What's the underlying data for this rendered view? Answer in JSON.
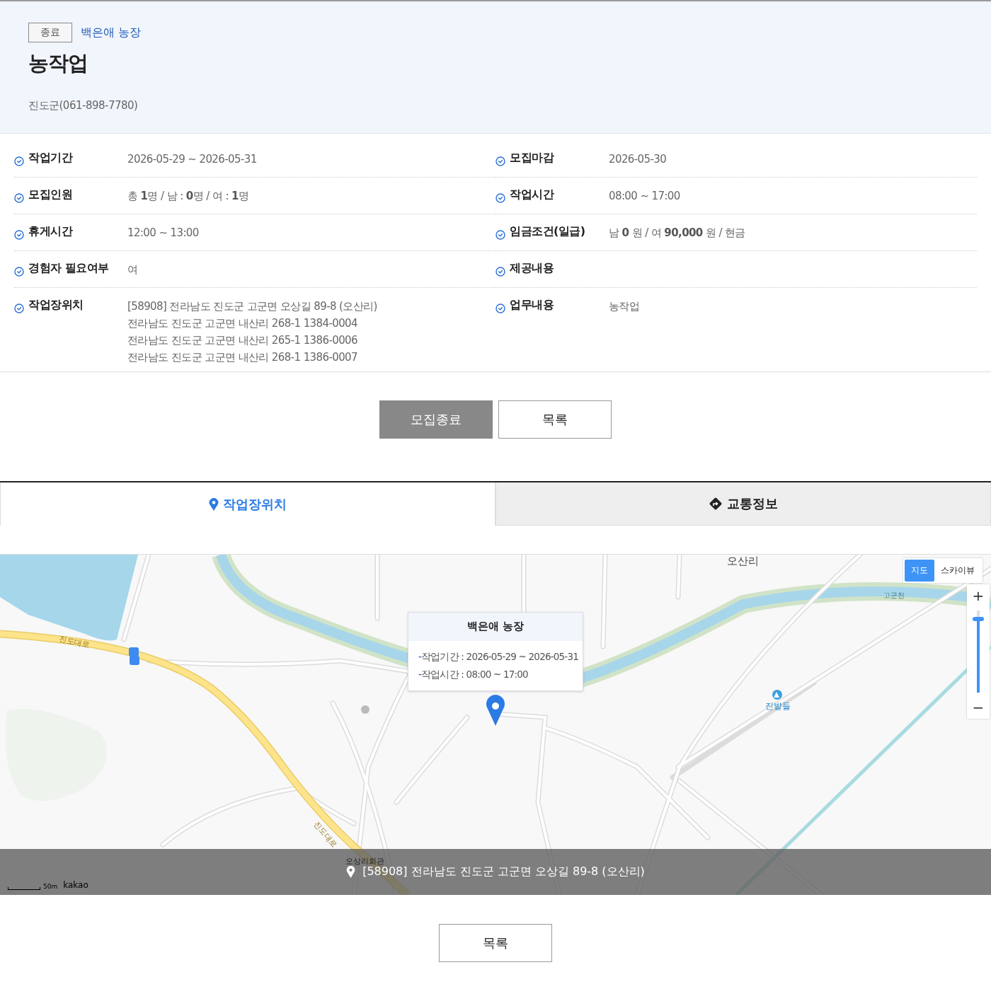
{
  "header": {
    "status_badge": "종료",
    "farm_link": "백은애 농장",
    "title": "농작업",
    "contact": "진도군(061-898-7780)"
  },
  "details": [
    {
      "label": "작업기간",
      "lines": [
        "2026-05-29 ~ 2026-05-31"
      ]
    },
    {
      "label": "모집마감",
      "lines": [
        "2026-05-30"
      ]
    },
    {
      "label": "모집인원",
      "lines": [
        "총 **1**명 / 남 : **0**명 / 여 : **1**명"
      ]
    },
    {
      "label": "작업시간",
      "lines": [
        "08:00 ~ 17:00"
      ]
    },
    {
      "label": "휴게시간",
      "lines": [
        "12:00 ~ 13:00"
      ]
    },
    {
      "label": "임금조건(일급)",
      "lines": [
        "남 **0** 원 / 여 **90,000** 원 / 현금"
      ]
    },
    {
      "label": "경험자 필요여부",
      "lines": [
        "여"
      ]
    },
    {
      "label": "제공내용"
    },
    {
      "label": "작업장위치",
      "lines": [
        "[58908] 전라남도 진도군 고군면 오상길 89-8 (오산리)",
        "전라남도 진도군 고군면 내산리 268-1 1384-0004",
        "전라남도 진도군 고군면 내산리 265-1 1386-0006",
        "전라남도 진도군 고군면 내산리 268-1 1386-0007"
      ]
    },
    {
      "label": "업무내용",
      "lines": [
        "농작업"
      ]
    }
  ],
  "actions": [
    {
      "label": "모집종료",
      "kind": "closed"
    },
    {
      "label": "목록",
      "kind": "plain"
    }
  ],
  "tabs": [
    {
      "label": "작업장위치",
      "selected": true
    },
    {
      "label": "교통정보",
      "selected": false
    }
  ],
  "map": {
    "type_buttons": [
      {
        "label": "지도",
        "selected": true
      },
      {
        "label": "스카이뷰",
        "selected": false
      }
    ],
    "zoom": {
      "in": "+",
      "out": "−",
      "level": 0.9
    },
    "place_labels": [
      {
        "text": "오산리",
        "kind": "area"
      },
      {
        "text": "진도대로",
        "kind": "road1"
      },
      {
        "text": "진도대로",
        "kind": "road2"
      },
      {
        "text": "고군천",
        "kind": "river"
      },
      {
        "text": "진밭들",
        "kind": "poi"
      },
      {
        "text": "오상리회관",
        "kind": "building"
      }
    ],
    "info_window": {
      "title": "백은애 농장",
      "lines": [
        {
          "marker": "-",
          "text": "작업기간 : 2026-05-29 ~ 2026-05-31"
        },
        {
          "marker": "-",
          "text": "작업시간 : 08:00 ~ 17:00"
        }
      ]
    },
    "address": "[58908] 전라남도 진도군 고군면 오상길 89-8 (오산리)",
    "scale": "50m",
    "brand": "kakao"
  },
  "footer_button": "목록"
}
